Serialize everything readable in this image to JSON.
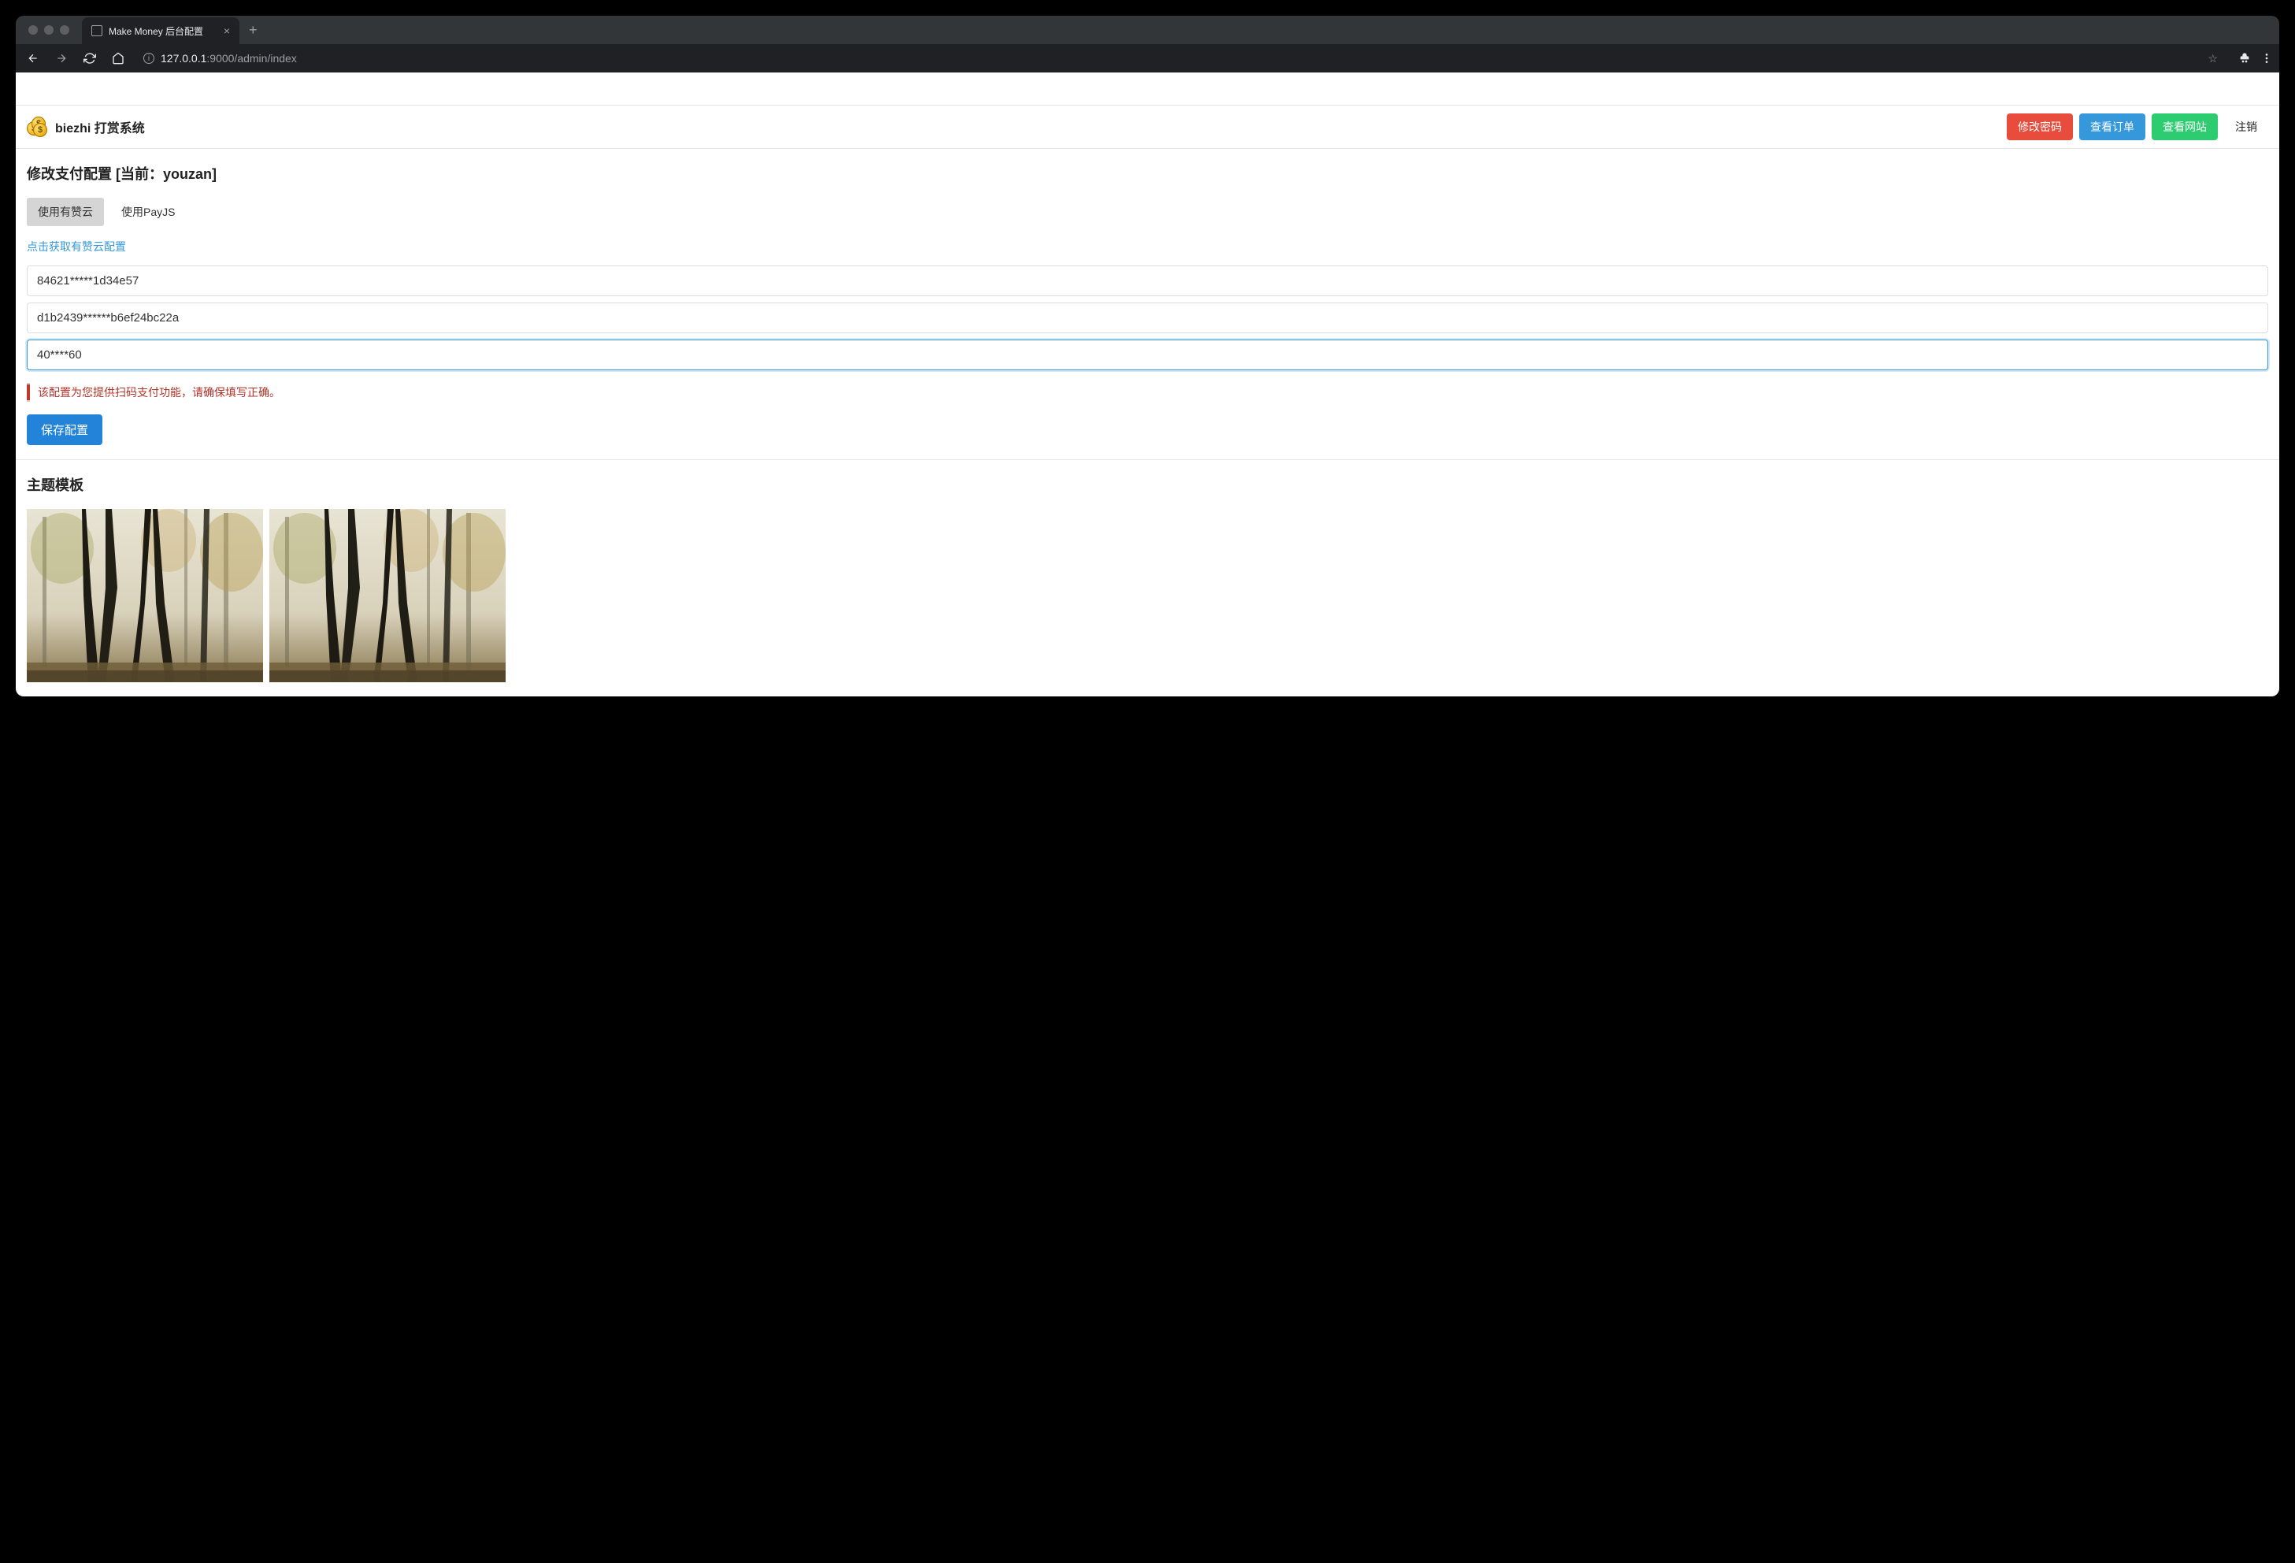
{
  "browser": {
    "tab_title": "Make Money 后台配置",
    "url_host": "127.0.0.1",
    "url_port_path": ":9000/admin/index"
  },
  "header": {
    "brand_title": "biezhi 打赏系统",
    "buttons": {
      "change_password": "修改密码",
      "view_orders": "查看订单",
      "view_site": "查看网站"
    },
    "logout": "注销"
  },
  "config": {
    "section_title": "修改支付配置 [当前：youzan]",
    "tabs": {
      "youzan": "使用有赞云",
      "payjs": "使用PayJS"
    },
    "help_link": "点击获取有赞云配置",
    "inputs": {
      "client_id": "84621*****1d34e57",
      "client_secret": "d1b2439******b6ef24bc22a",
      "kdt_id": "40****60"
    },
    "warning": "该配置为您提供扫码支付功能，请确保填写正确。",
    "save_label": "保存配置"
  },
  "themes": {
    "section_title": "主题模板"
  }
}
